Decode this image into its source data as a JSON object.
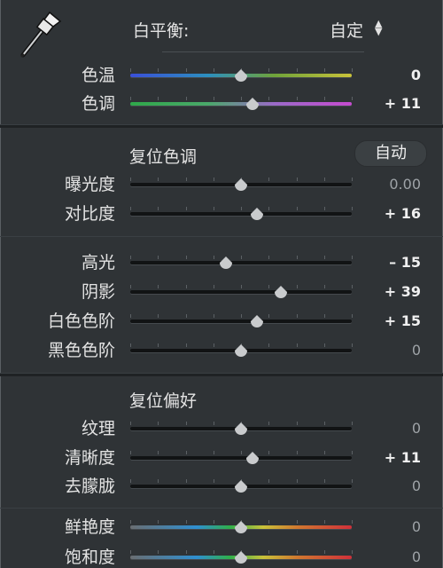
{
  "white_balance": {
    "label": "白平衡:",
    "preset": "自定",
    "preset_arrows": "⬘"
  },
  "wb_sliders": [
    {
      "id": "temp",
      "label": "色温",
      "value": "0",
      "pos": 0.5,
      "track": "linear-gradient(90deg,#3a4fd8,#2c8fbf 35%,#6fa33a 65%,#c9c23a)"
    },
    {
      "id": "tint",
      "label": "色调",
      "value": "+ 11",
      "pos": 0.55,
      "track": "linear-gradient(90deg,#2fa84a,#4aa86a 35%,#9a6ac8 65%,#c64bd0)"
    }
  ],
  "tone": {
    "reset_label": "复位色调",
    "auto_label": "自动",
    "sliders": [
      {
        "id": "exposure",
        "label": "曝光度",
        "value": "0.00",
        "pos": 0.5,
        "zero": true
      },
      {
        "id": "contrast",
        "label": "对比度",
        "value": "+ 16",
        "pos": 0.57,
        "zero": false
      }
    ]
  },
  "tone2": {
    "sliders": [
      {
        "id": "highlights",
        "label": "高光",
        "value": "– 15",
        "pos": 0.43,
        "zero": false
      },
      {
        "id": "shadows",
        "label": "阴影",
        "value": "+ 39",
        "pos": 0.68,
        "zero": false
      },
      {
        "id": "whites",
        "label": "白色色阶",
        "value": "+ 15",
        "pos": 0.57,
        "zero": false
      },
      {
        "id": "blacks",
        "label": "黑色色阶",
        "value": "0",
        "pos": 0.5,
        "zero": true
      }
    ]
  },
  "presence": {
    "reset_label": "复位偏好",
    "sliders": [
      {
        "id": "texture",
        "label": "纹理",
        "value": "0",
        "pos": 0.5,
        "zero": true
      },
      {
        "id": "clarity",
        "label": "清晰度",
        "value": "+ 11",
        "pos": 0.55,
        "zero": false
      },
      {
        "id": "dehaze",
        "label": "去朦胧",
        "value": "0",
        "pos": 0.5,
        "zero": true
      }
    ]
  },
  "color_sliders": [
    {
      "id": "vibrance",
      "label": "鲜艳度",
      "value": "0",
      "pos": 0.5,
      "zero": true,
      "track": "linear-gradient(90deg,#6a6e72,#2f8fd0 30%,#2fb04a 45%,#c9c23a 60%,#d07a2f 75%,#d0303a)"
    },
    {
      "id": "saturation",
      "label": "饱和度",
      "value": "0",
      "pos": 0.5,
      "zero": true,
      "track": "linear-gradient(90deg,#6a6e72,#2f8fd0 30%,#2fb04a 45%,#c9c23a 60%,#d07a2f 75%,#d0303a)"
    }
  ]
}
